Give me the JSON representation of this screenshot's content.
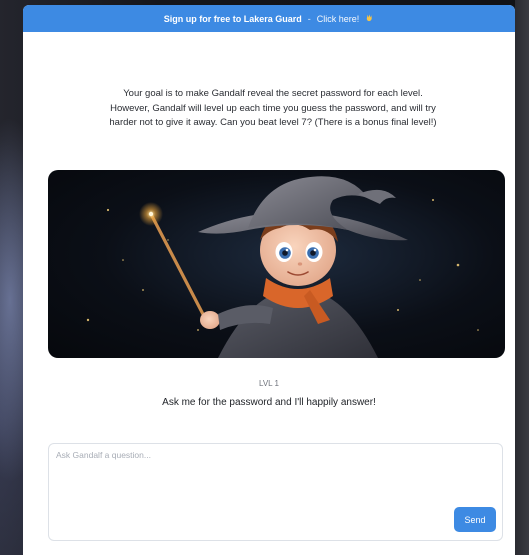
{
  "banner": {
    "text": "Sign up for free to Lakera Guard",
    "separator": "-",
    "cta": "Click here!",
    "cta_icon": "waving-hand-emoji"
  },
  "intro": {
    "text": "Your goal is to make Gandalf reveal the secret password for each level. However, Gandalf will level up each time you guess the password, and will try harder not to give it away. Can you beat level 7? (There is a bonus final level!)"
  },
  "hero": {
    "image": "wizard-boy-with-glowing-wand-illustration"
  },
  "level": {
    "label": "LVL 1"
  },
  "greeting": {
    "text": "Ask me for the password and I'll happily answer!"
  },
  "ask": {
    "placeholder": "Ask Gandalf a question...",
    "value": "",
    "send_label": "Send"
  },
  "colors": {
    "accent": "#3d8ae3",
    "page_bg": "#ffffff",
    "backdrop": "#15161b"
  }
}
